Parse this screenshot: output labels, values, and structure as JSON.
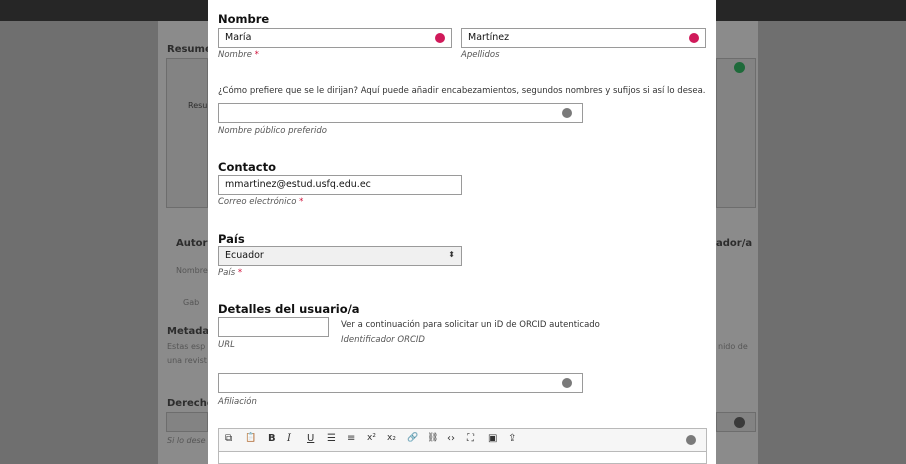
{
  "background": {
    "resumen": "Resume",
    "resu": "Resu",
    "autor": "Autor",
    "nombre_col": "Nombre",
    "gab": "Gab",
    "metadat": "Metadat",
    "estas": "Estas esp",
    "una": "una revist",
    "derecho": "Derecho",
    "si_lo": "Si lo dese",
    "right_tab": "ador/a",
    "right_text": "nido de"
  },
  "sections": {
    "nombre_title": "Nombre",
    "contacto_title": "Contacto",
    "pais_title": "País",
    "detalles_title": "Detalles del usuario/a"
  },
  "fields": {
    "given_name": "María",
    "given_name_label": "Nombre",
    "family_name": "Martínez",
    "family_name_label": "Apellidos",
    "preferred_help": "¿Cómo prefiere que se le dirijan? Aquí puede añadir encabezamientos, segundos nombres y sufijos si así lo desea.",
    "preferred_value": "",
    "preferred_label": "Nombre público preferido",
    "email": "mmartinez@estud.usfq.edu.ec",
    "email_label": "Correo electrónico",
    "country": "Ecuador",
    "country_label": "País",
    "url_value": "",
    "url_label": "URL",
    "orcid_help": "Ver a continuación para solicitar un iD de ORCID autenticado",
    "orcid_label": "Identificador ORCID",
    "affiliation_value": "",
    "affiliation_label": "Afiliación",
    "required_mark": "*"
  },
  "toolbar": {
    "copy": "⧉",
    "paste": "📋",
    "bold": "B",
    "italic": "I",
    "underline": "U",
    "bullets": "☰",
    "numbered": "≡",
    "superscript": "x²",
    "subscript": "x₂",
    "link": "🔗",
    "unlink": "⛓",
    "code": "‹›",
    "fullscreen": "⛶",
    "image": "▣",
    "upload": "⇪"
  }
}
